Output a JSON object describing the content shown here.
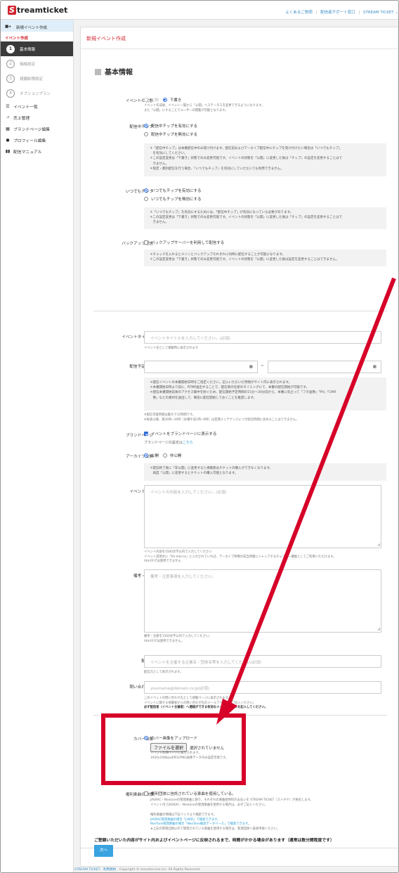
{
  "header": {
    "logo_initial": "S",
    "logo_rest": "treamticket",
    "nav": [
      "よくあるご質問",
      "配信者サポート窓口",
      "STREAM TICKET ⌄"
    ]
  },
  "sidebar": {
    "new_event": "新規イベント作成",
    "sub_title": "イベント作成",
    "steps": [
      {
        "num": "1",
        "label": "基本情報"
      },
      {
        "num": "2",
        "label": "価格設定"
      },
      {
        "num": "3",
        "label": "視聴制限設定"
      },
      {
        "num": "4",
        "label": "オプションプラン"
      }
    ],
    "items": [
      "イベント一覧",
      "売上管理",
      "ブランドページ編集",
      "プロフィール編集",
      "配信マニュアル"
    ]
  },
  "page": {
    "title": "新規イベント作成",
    "section": "基本情報"
  },
  "form": {
    "status": {
      "label": "イベントの状態",
      "opt_public": "公開",
      "opt_draft": "下書き",
      "help": [
        "イベント作成後、イベント一覧から「公開」へステータスを変更できるようになります。",
        "また「公開」にすることでユーザーの閲覧が可能となります。"
      ]
    },
    "live_chip": {
      "label": "配信中チップ",
      "opt_on": "配信中チップを有効にする",
      "opt_off": "配信中チップを無効にする",
      "notes": [
        "＊「配信中チップ」は本番配信中のみ受け付けます。配信前およびアーカイブ配信中にチップを受け付けたい場合は「いつでもチップ」",
        "　を有効にしてください。",
        "＊この設定変更は「下書き」状態でのみ変更可能です。イベントの状態を「公開」に変更した後は「チップ」の設定を変更することはで",
        "　きません。",
        "＊限定・無料配信を行う場合、「いつでもチップ」を有効にしていただいても利用できません。"
      ]
    },
    "anytime_chip": {
      "label": "いつでもチップ",
      "opt_on": "いつでもチップを有効にする",
      "opt_off": "いつでもチップを無効にする",
      "notes": [
        "＊「いつでもチップ」を有効にするためには、「配信中チップ」が有効になっている必要があります。",
        "＊この設定変更は「下書き」状態でのみ変更可能です。イベントの状態を「公開」に変更した後は「チップ」の設定を変更することはで",
        "　きません。"
      ]
    },
    "backup": {
      "label": "バックアップ配信",
      "check_label": "バックアップサーバーを利用して配信する",
      "notes": [
        "＊チェックを入れるとメインとバックアップそれぞれに同時に配信することが可能になります。",
        "＊この設定変更は「下書き」状態でのみ変更可能です。イベントの状態を「公開」に変更した後は設定を変更することはできません。"
      ]
    },
    "event_title": {
      "label": "イベントタイトル",
      "placeholder": "イベントタイトルを入力してください。(必須)",
      "help": "イベント名として掲載時に表示されます"
    },
    "schedule": {
      "label": "配信予定日時",
      "tilde": "~",
      "notes": [
        "＊配信イベントの本番開始日時をご指定ください。記入いただいた時間がサイト内に表示されます。",
        "＊本番開始日時より前に、RTMP送出することで、配信者の任意のタイミングにて、本番の配信開始が可能です。",
        "＊配信本番開始前後のアクセス集中を防ぐため、配信開始予定時間の15分～30分前から、本番に先立って「フタ画像」「PV」「CMR",
        "　像」などの素材を送出して、事前に配信開始しておくことを推奨します。"
      ],
      "help": [
        "※配信可能時間は最大で12時間です。",
        "※毎週火曜、夜26時~30時（水曜午前2時~6時）は定期メンテナンスにつき配信時間に含めることはできません。"
      ]
    },
    "brand_page": {
      "label": "ブランドページ",
      "check_label": "イベントをブランドページに表示する",
      "setting_text": "ブランドページの設定は",
      "setting_link": "こちら"
    },
    "archive": {
      "label": "アーカイブ公開",
      "opt_public": "公開",
      "opt_private": "非公開",
      "notes": [
        "＊配信終了後に「非公開」に変更すると視聴者はチケットの購入ができなくなります。",
        "　再度「公開」に変更するとチケットの購入可能となります。"
      ]
    },
    "description": {
      "label": "イベント説明",
      "placeholder": "イベントの内容を入力してください。(必須)",
      "help": [
        "イベント内容を1500文字以内で入力してください",
        "イベント説明文に「hh:mm:ss」と入力されていれば、アーカイブ映像の該当時間にジャンプするチャプター機能としてご利用いただけます。",
        "htmlタグは使用できません"
      ]
    },
    "remarks": {
      "label": "備考・注意",
      "placeholder": "備考・注意事項を入力してください。",
      "help": [
        "備考・注意を1500文字以内で入力してください。",
        "htmlタグは使用できません。"
      ]
    },
    "distributor": {
      "label": "配信元",
      "placeholder": "イベントを主催する企業名・団体名等を入力してください(必須)",
      "help": "配信元として表示されます。"
    },
    "contact": {
      "label": "問い合わせ先",
      "placeholder": "yourname@domain.co.jp(必須)",
      "help": [
        "このイベントの問い合わせ先として視聴ページに表示されます。",
        "イベントに関する視聴者からの問い合わせ先のメールアドレスをご記入ください。"
      ],
      "help_bold": "必ず配信者（イベント主催者）へ連絡ができる有効なメールアドレスを記入してください。"
    },
    "cover": {
      "label": "カバー画像",
      "opt_upload": "カバー画像をアップロード",
      "file_button": "ファイルを選択",
      "file_status": "選択されていません",
      "help": [
        "イベント詳細ページに表示されます。",
        "1920x1080px/JPEG/PNG画像データのみ設定可能です。"
      ],
      "opt_existing": "既存画像からカバー画像を設定する"
    },
    "rights": {
      "label": "権利楽曲の申請",
      "check_label": "権利団体に信託されている楽曲を使用している。",
      "notes": [
        "JASRAC・Nextoneの管理楽曲に限り、それぞれの楽曲使用料の支払いを STREAM TICKET（ストチケ）が負担します。",
        "イベント内でJASRAC・Nextoneの管理楽曲を使用する場合は、必ずご記入ください。"
      ],
      "search_intro": "権利楽曲の情報は下記リンクより検索できます。",
      "link1": "JASRAC管理楽曲の場合「J-WID」で検索できます。",
      "link2": "NexTone管理楽曲の場合「NexTone検索データベース」で検索できます。",
      "note_last": "★上記の管理団体以外で管理されている楽曲を使用する場合は、管理団体へ直接申請ください。"
    }
  },
  "footer_note": "ご登録いただいた内容がサイト内およびイベントページに反映されるまで、時間がかかる場合があります（通常は数分間程度です）",
  "next_button": "次へ",
  "footer": {
    "brand": "STREAM TICKET",
    "terms": "利用規約",
    "copyright": "Copyright © monstervive inc. All Rights Reserved."
  },
  "colors": {
    "accent": "#d1242f",
    "primary": "#3aa3e0",
    "annotation": "#d60028"
  }
}
